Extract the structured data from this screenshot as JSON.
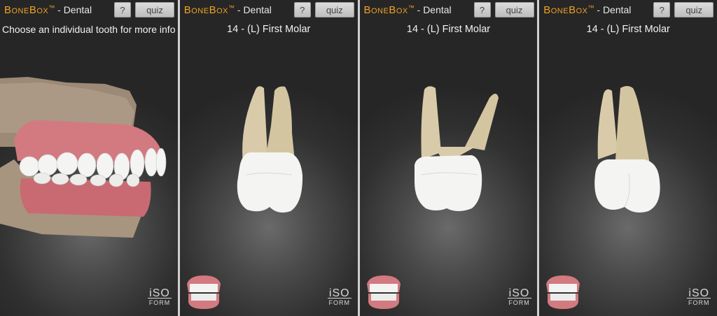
{
  "panels": [
    {
      "brand": "BoneBox",
      "tm": "™",
      "suffix": " - Dental",
      "help_label": "?",
      "quiz_label": "quiz",
      "title": "Choose an individual tooth for more info",
      "logo_top": "iSO",
      "logo_bottom": "FORM",
      "view": "jaw"
    },
    {
      "brand": "BoneBox",
      "tm": "™",
      "suffix": " - Dental",
      "help_label": "?",
      "quiz_label": "quiz",
      "title": "14 - (L) First Molar",
      "logo_top": "iSO",
      "logo_bottom": "FORM",
      "view": "molar-buccal"
    },
    {
      "brand": "BoneBox",
      "tm": "™",
      "suffix": " - Dental",
      "help_label": "?",
      "quiz_label": "quiz",
      "title": "14 - (L) First Molar",
      "logo_top": "iSO",
      "logo_bottom": "FORM",
      "view": "molar-mesial"
    },
    {
      "brand": "BoneBox",
      "tm": "™",
      "suffix": " - Dental",
      "help_label": "?",
      "quiz_label": "quiz",
      "title": "14 - (L) First Molar",
      "logo_top": "iSO",
      "logo_bottom": "FORM",
      "view": "molar-lingual"
    }
  ],
  "colors": {
    "brand": "#f0a224",
    "background": "#303030",
    "enamel": "#f4f4f2",
    "root": "#d9cbaa",
    "gum": "#d27a80"
  }
}
